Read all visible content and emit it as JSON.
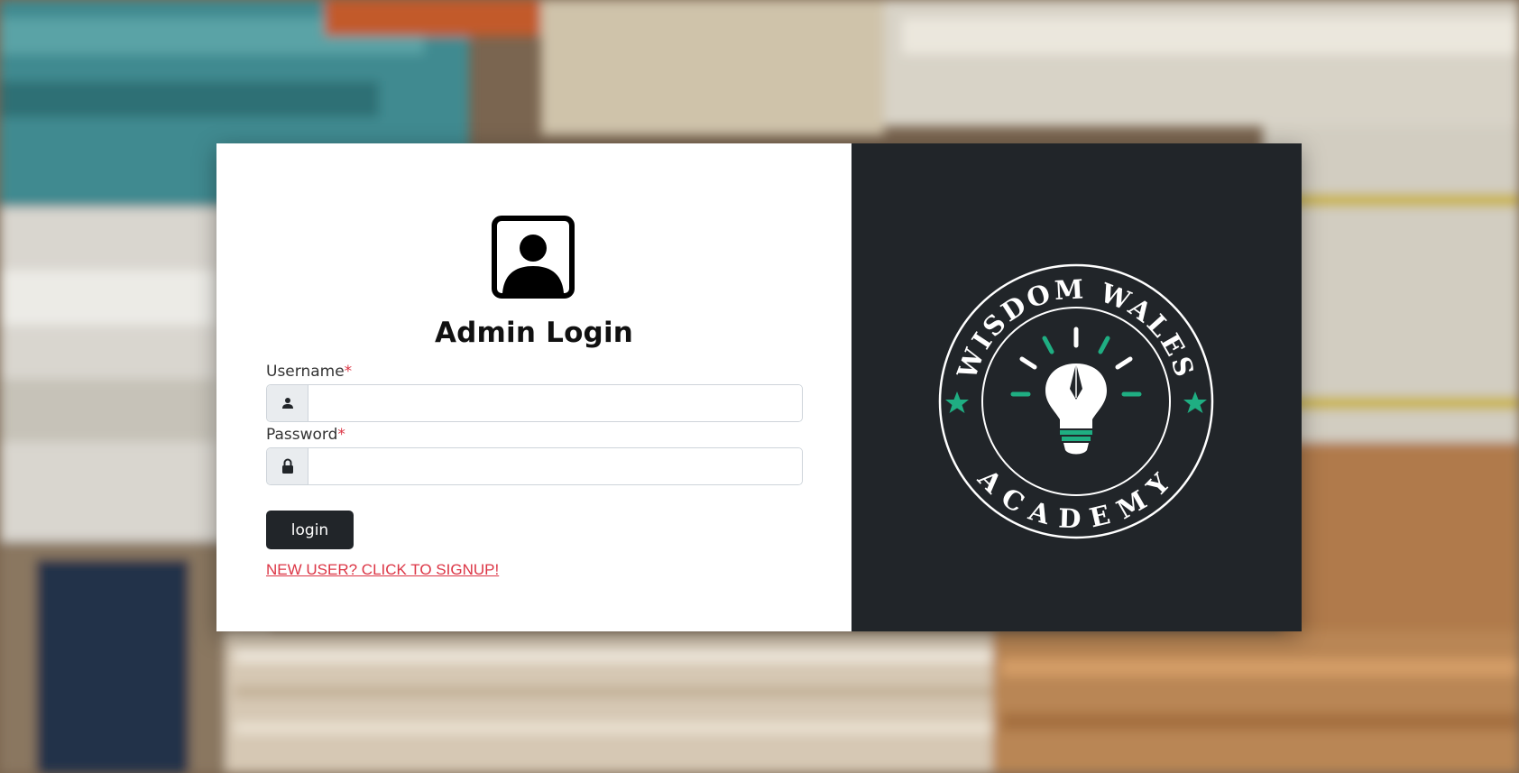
{
  "page": {
    "title": "Admin Login"
  },
  "form": {
    "username_label": "Username",
    "username_required_mark": "*",
    "username_value": "",
    "username_placeholder": "",
    "password_label": "Password",
    "password_required_mark": "*",
    "password_value": "",
    "password_placeholder": "",
    "login_button_label": "login",
    "signup_link_text": "NEW USER? CLICK TO SIGNUP!"
  },
  "brand": {
    "logo_top_text": "WISDOM WALES",
    "logo_bottom_text": "ACADEMY"
  },
  "icons": {
    "avatar": "user-portrait-icon",
    "username_addon": "person-icon",
    "password_addon": "lock-icon"
  },
  "colors": {
    "accent_dark": "#212529",
    "required_red": "#dc3545",
    "logo_green": "#1fae82",
    "card_left_bg": "#ffffff"
  }
}
